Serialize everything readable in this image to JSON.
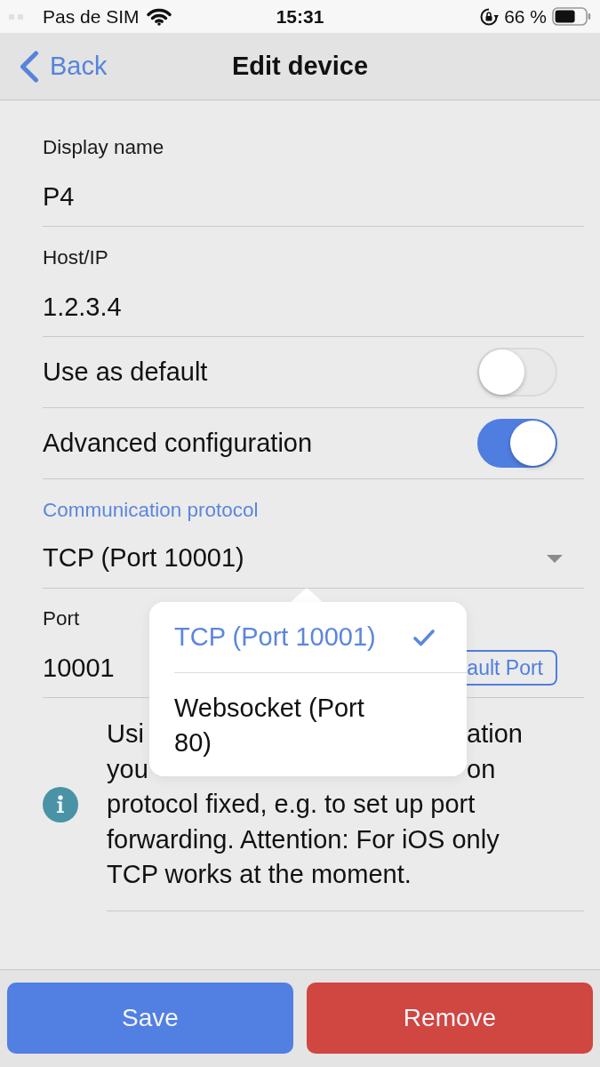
{
  "status_bar": {
    "carrier": "Pas de SIM",
    "time": "15:31",
    "battery": "66 %"
  },
  "nav_bar": {
    "back": "Back",
    "title": "Edit device"
  },
  "form": {
    "fields": [
      {
        "kind": "text",
        "label": "Display name",
        "value": "P4"
      },
      {
        "kind": "text",
        "label": "Host/IP",
        "value": "1.2.3.4"
      },
      {
        "kind": "toggle",
        "label": "Use as default",
        "on": false
      },
      {
        "kind": "toggle",
        "label": "Advanced configuration",
        "on": true
      },
      {
        "kind": "select",
        "label": "Communication protocol",
        "value": "TCP (Port 10001)",
        "expanded": true,
        "menu": {
          "options": [
            {
              "label": "TCP (Port 10001)",
              "selected": true
            },
            {
              "label": "Websocket (Port 80)",
              "selected": false
            }
          ]
        }
      },
      {
        "kind": "port",
        "label": "Port",
        "value": "10001",
        "button": "ault Port"
      }
    ]
  },
  "info": {
    "covered_lines": [
      [
        "Usi",
        "ation"
      ],
      [
        "you",
        "on"
      ]
    ],
    "text": "protocol fixed, e.g. to set up port forwarding. Attention: For iOS only TCP works at the moment."
  },
  "actions": [
    {
      "kind": "primary",
      "label": "Save"
    },
    {
      "kind": "danger",
      "label": "Remove"
    }
  ]
}
